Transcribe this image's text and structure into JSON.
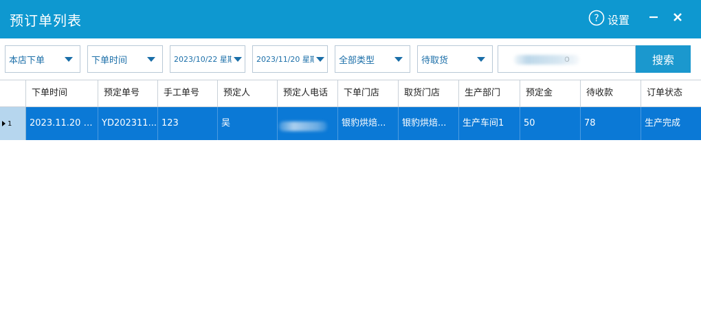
{
  "window": {
    "title": "预订单列表",
    "settings_label": "设置",
    "accent_color": "#0e98d0"
  },
  "filters": {
    "order_source": "本店下单",
    "date_type": "下单时间",
    "start_date": "2023/10/22 星期",
    "end_date": "2023/11/20 星期",
    "category": "全部类型",
    "status": "待取货",
    "search_value": "o",
    "search_button": "搜索"
  },
  "table": {
    "columns": [
      "下单时间",
      "预定单号",
      "手工单号",
      "预定人",
      "预定人电话",
      "下单门店",
      "取货门店",
      "生产部门",
      "预定金",
      "待收款",
      "订单状态"
    ],
    "rows": [
      {
        "index": "1",
        "cells": [
          "2023.11.20 1...",
          "YD202311...",
          "123",
          "吴",
          "",
          "银豹烘焙...",
          "银豹烘焙...",
          "生产车间1",
          "50",
          "78",
          "生产完成"
        ]
      }
    ],
    "selected_row_color": "#0b79d6"
  }
}
